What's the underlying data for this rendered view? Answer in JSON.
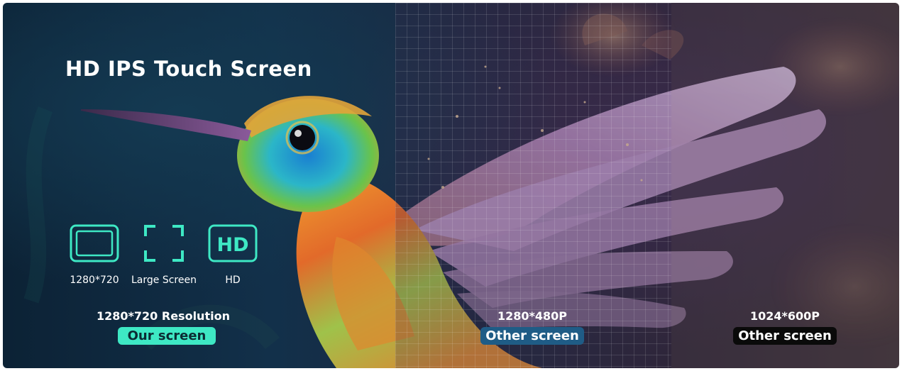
{
  "title": "HD IPS Touch Screen",
  "colors": {
    "accent": "#3ee8c4",
    "badge_mid": "#1f5c86",
    "badge_right": "#0a0a0a"
  },
  "features": [
    {
      "label": "1280*720",
      "icon": "screen-icon"
    },
    {
      "label": "Large Screen",
      "icon": "fullscreen-corners-icon"
    },
    {
      "label": "HD",
      "icon": "hd-icon",
      "icon_text": "HD"
    }
  ],
  "comparisons": {
    "ours": {
      "caption": "1280*720 Resolution",
      "badge": "Our screen"
    },
    "mid": {
      "caption": "1280*480P",
      "badge": "Other screen"
    },
    "right": {
      "caption": "1024*600P",
      "badge": "Other screen"
    }
  }
}
